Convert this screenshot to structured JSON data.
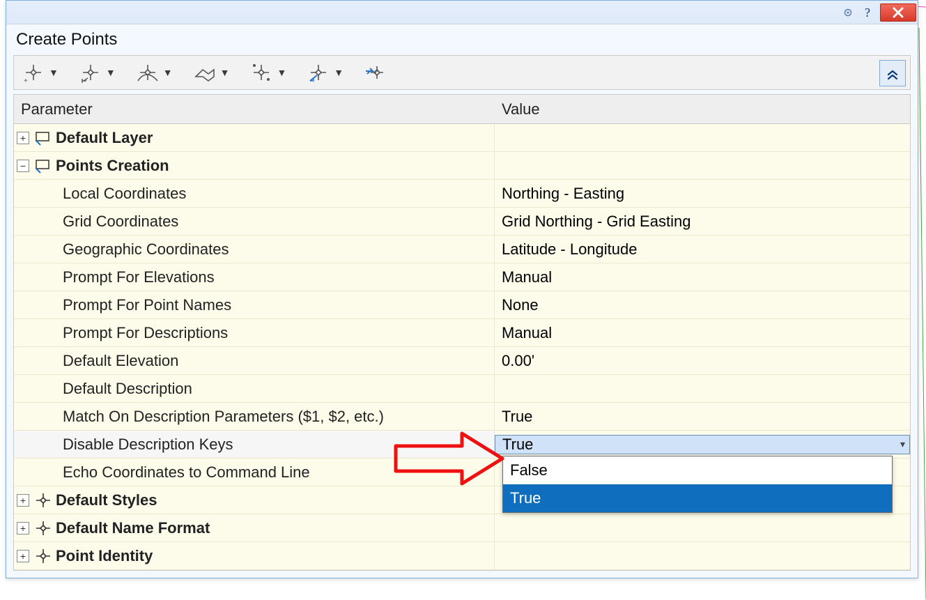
{
  "title": "Create Points",
  "columns": {
    "parameter": "Parameter",
    "value": "Value"
  },
  "categories": {
    "default_layer": "Default Layer",
    "points_creation": "Points Creation",
    "default_styles": "Default Styles",
    "default_name_format": "Default Name Format",
    "point_identity": "Point Identity"
  },
  "params": {
    "local_coords": {
      "label": "Local Coordinates",
      "value": "Northing - Easting"
    },
    "grid_coords": {
      "label": "Grid Coordinates",
      "value": "Grid Northing - Grid Easting"
    },
    "geo_coords": {
      "label": "Geographic Coordinates",
      "value": "Latitude - Longitude"
    },
    "prompt_elev": {
      "label": "Prompt For Elevations",
      "value": "Manual"
    },
    "prompt_names": {
      "label": "Prompt For Point Names",
      "value": "None"
    },
    "prompt_desc": {
      "label": "Prompt For Descriptions",
      "value": "Manual"
    },
    "default_elev": {
      "label": "Default Elevation",
      "value": "0.00'"
    },
    "default_desc": {
      "label": "Default Description",
      "value": ""
    },
    "match_desc": {
      "label": "Match On Description Parameters ($1, $2, etc.)",
      "value": "True"
    },
    "disable_desc_keys": {
      "label": "Disable Description Keys",
      "value": "True"
    },
    "echo_cmd": {
      "label": "Echo Coordinates to Command Line",
      "value": ""
    }
  },
  "dropdown": {
    "opt_false": "False",
    "opt_true": "True"
  }
}
